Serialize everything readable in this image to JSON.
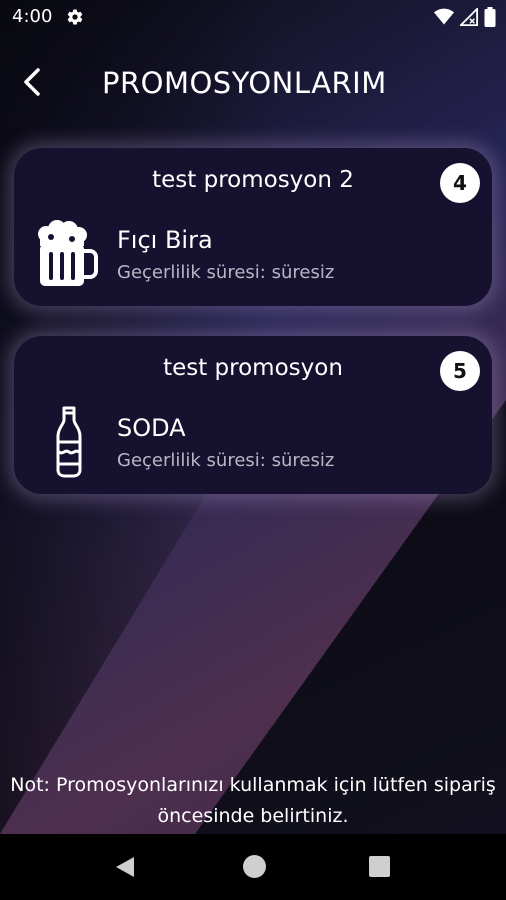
{
  "status_bar": {
    "time": "4:00",
    "icons": [
      "gear-icon",
      "wifi-icon",
      "signal-icon",
      "battery-icon"
    ]
  },
  "header": {
    "title": "PROMOSYONLARIM",
    "back_icon": "chevron-left-icon"
  },
  "promotions": [
    {
      "title": "test promosyon 2",
      "count": "4",
      "item_name": "Fıçı Bira",
      "validity": "Geçerlilik süresi: süresiz",
      "icon": "beer-mug-icon"
    },
    {
      "title": "test promosyon",
      "count": "5",
      "item_name": "SODA",
      "validity": "Geçerlilik süresi: süresiz",
      "icon": "soda-bottle-icon"
    }
  ],
  "note": {
    "line1": "Not: Promosyonlarınızı kullanmak için lütfen sipariş",
    "line2": "öncesinde belirtiniz."
  },
  "nav_bar": {
    "icons": [
      "back-triangle-icon",
      "home-circle-icon",
      "recents-square-icon"
    ]
  },
  "colors": {
    "card_background": "#15112f",
    "badge_background": "#ffffff",
    "accent_glow": "#aa96c8"
  }
}
